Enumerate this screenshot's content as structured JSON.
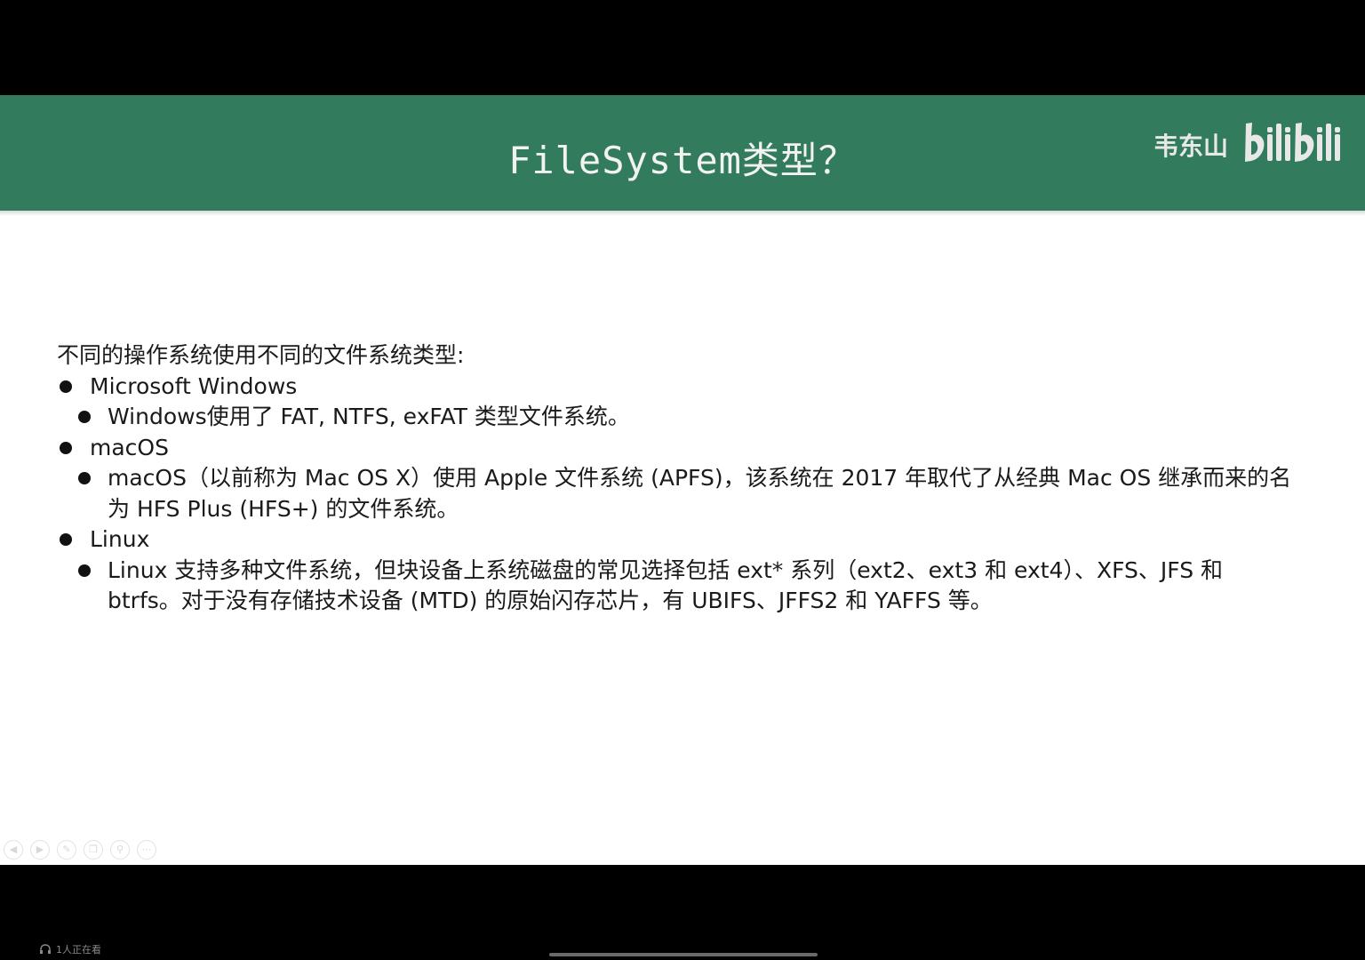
{
  "slide": {
    "title": "FileSystem类型？",
    "watermark": {
      "name": "韦东山",
      "logo_text": "bilibili"
    },
    "intro": "不同的操作系统使用不同的文件系统类型:",
    "items": [
      {
        "label": "Microsoft Windows",
        "details": [
          "Windows使用了 FAT, NTFS, exFAT 类型文件系统。"
        ]
      },
      {
        "label": "macOS",
        "details": [
          "macOS（以前称为 Mac OS X）使用 Apple 文件系统 (APFS)，该系统在 2017 年取代了从经典 Mac OS 继承而来的名为 HFS Plus (HFS+) 的文件系统。"
        ]
      },
      {
        "label": "Linux",
        "details": [
          "Linux 支持多种文件系统，但块设备上系统磁盘的常见选择包括 ext* 系列（ext2、ext3 和 ext4）、XFS、JFS 和 btrfs。对于没有存储技术设备 (MTD) 的原始闪存芯片，有 UBIFS、JFFS2 和 YAFFS 等。"
        ]
      }
    ]
  },
  "player": {
    "viewers_text": "1人正在看",
    "toolbar_icons": [
      "prev-icon",
      "next-icon",
      "pen-icon",
      "copy-icon",
      "zoom-icon",
      "more-icon"
    ]
  },
  "colors": {
    "header_bg": "#327c5d",
    "title_text": "#f2f2f2",
    "body_text": "#1a1a1a",
    "frame": "#000000"
  }
}
